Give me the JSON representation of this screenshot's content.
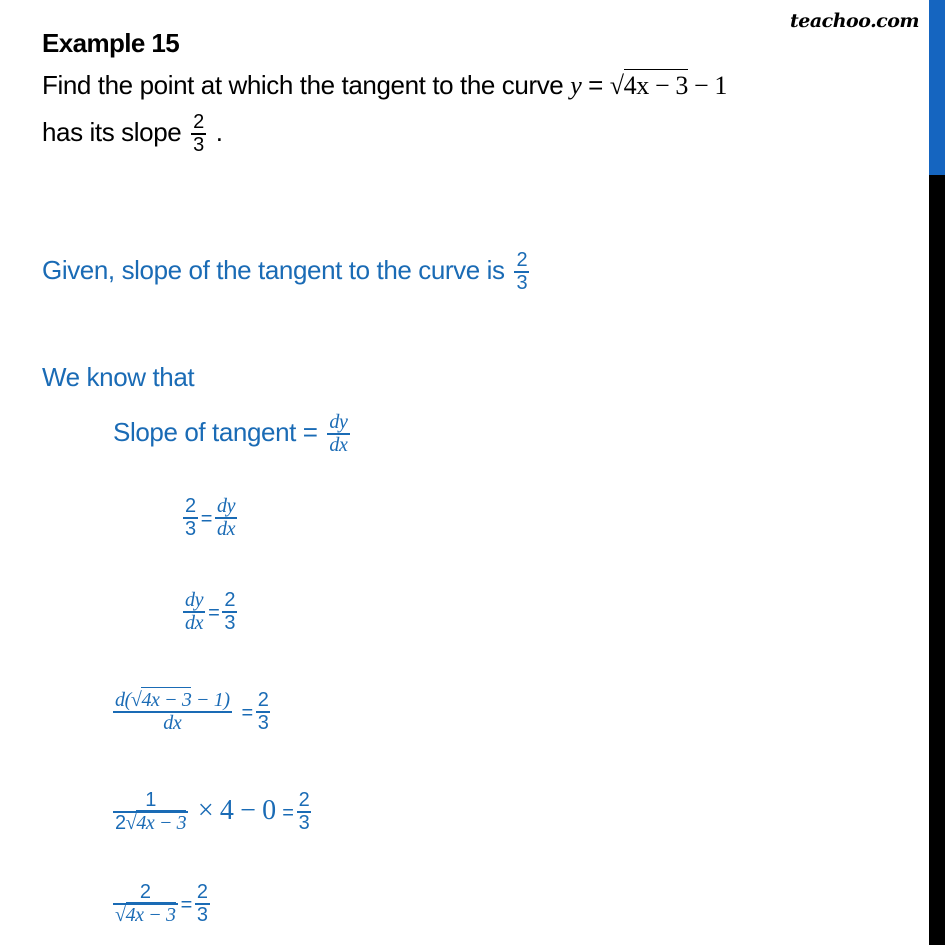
{
  "logo": "teachoo.com",
  "title": "Example 15",
  "question": {
    "line1_text": "Find the point at which the tangent to the curve ",
    "line1_math_y": "y",
    "line1_eq": " = ",
    "line1_sqrt_symbol": "√",
    "line1_radicand": "4x − 3",
    "line1_tail": " − 1",
    "line2_text": "has its slope ",
    "slope_num": "2",
    "slope_den": "3",
    "line2_tail": " ."
  },
  "given": {
    "text": "Given, slope of the tangent to the curve is ",
    "num": "2",
    "den": "3"
  },
  "know": {
    "text": "We know that"
  },
  "steps": [
    {
      "lhs": "Slope of tangent = ",
      "rhs_num": "dy",
      "rhs_den": "dx"
    },
    {
      "lhs_num": "2",
      "lhs_den": "3",
      "eq": "=",
      "rhs_num": "dy",
      "rhs_den": "dx"
    },
    {
      "lhs_num": "dy",
      "lhs_den": "dx",
      "eq": "=",
      "rhs_num": "2",
      "rhs_den": "3"
    },
    {
      "lhs_num_prefix": "d(",
      "lhs_num_sqrt": "√",
      "lhs_num_radicand": "4x − 3",
      "lhs_num_suffix": " − 1)",
      "lhs_den": "dx",
      "eq": "=",
      "rhs_num": "2",
      "rhs_den": "3"
    },
    {
      "lhs_num": "1",
      "lhs_den_prefix": "2",
      "lhs_den_sqrt": "√",
      "lhs_den_radicand": "4x − 3",
      "mid": " × 4 − 0 ",
      "eq": "=",
      "rhs_num": "2",
      "rhs_den": "3"
    },
    {
      "lhs_num": "2",
      "lhs_den_sqrt": "√",
      "lhs_den_radicand": "4x − 3",
      "eq": "=",
      "rhs_num": "2",
      "rhs_den": "3"
    }
  ],
  "colors": {
    "accent_blue": "#1a6bb5",
    "sidebar_blue": "#1565c0",
    "sidebar_black": "#000000"
  }
}
